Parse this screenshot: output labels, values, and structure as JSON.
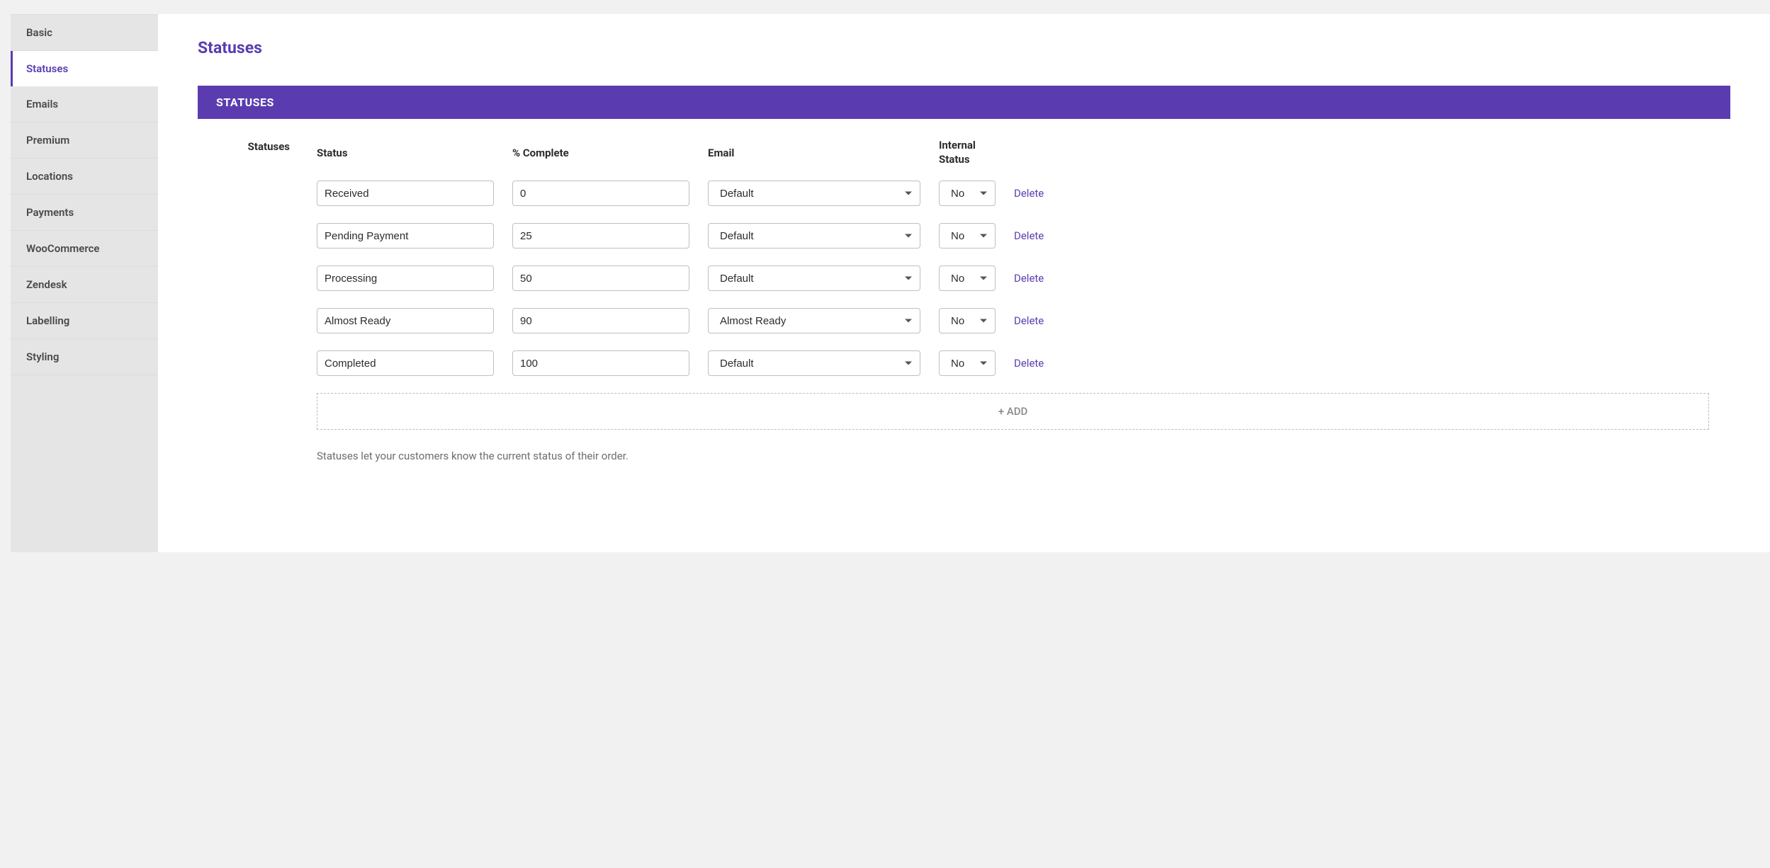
{
  "sidebar": {
    "items": [
      {
        "label": "Basic",
        "active": false
      },
      {
        "label": "Statuses",
        "active": true
      },
      {
        "label": "Emails",
        "active": false
      },
      {
        "label": "Premium",
        "active": false
      },
      {
        "label": "Locations",
        "active": false
      },
      {
        "label": "Payments",
        "active": false
      },
      {
        "label": "WooCommerce",
        "active": false
      },
      {
        "label": "Zendesk",
        "active": false
      },
      {
        "label": "Labelling",
        "active": false
      },
      {
        "label": "Styling",
        "active": false
      }
    ]
  },
  "page": {
    "title": "Statuses",
    "section_header": "STATUSES",
    "row_label": "Statuses",
    "columns": {
      "status": "Status",
      "percent": "% Complete",
      "email": "Email",
      "internal": "Internal Status"
    },
    "rows": [
      {
        "status": "Received",
        "percent": "0",
        "email": "Default",
        "internal": "No",
        "delete": "Delete"
      },
      {
        "status": "Pending Payment",
        "percent": "25",
        "email": "Default",
        "internal": "No",
        "delete": "Delete"
      },
      {
        "status": "Processing",
        "percent": "50",
        "email": "Default",
        "internal": "No",
        "delete": "Delete"
      },
      {
        "status": "Almost Ready",
        "percent": "90",
        "email": "Almost Ready",
        "internal": "No",
        "delete": "Delete"
      },
      {
        "status": "Completed",
        "percent": "100",
        "email": "Default",
        "internal": "No",
        "delete": "Delete"
      }
    ],
    "add_label": "+ ADD",
    "help_text": "Statuses let your customers know the current status of their order."
  }
}
